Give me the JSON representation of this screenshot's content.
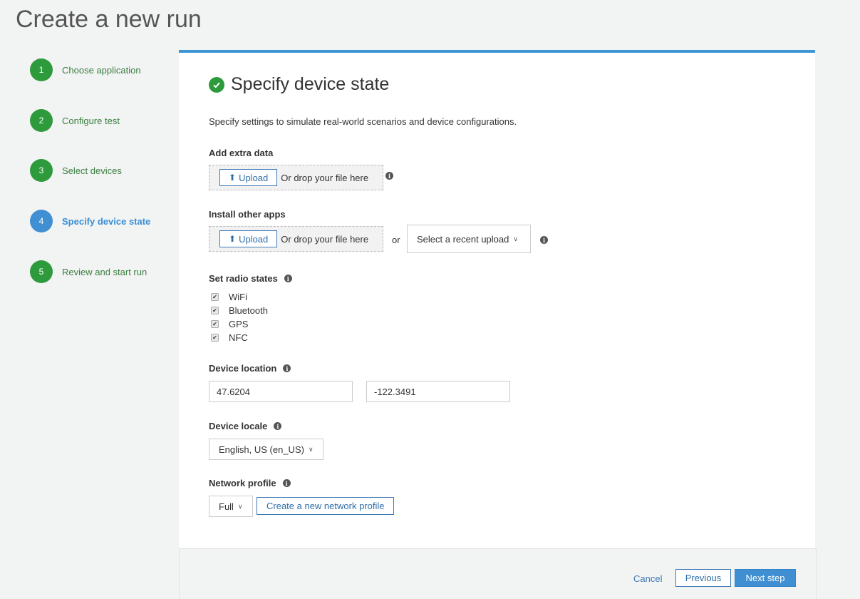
{
  "page": {
    "title": "Create a new run"
  },
  "steps": [
    {
      "num": "1",
      "label": "Choose application"
    },
    {
      "num": "2",
      "label": "Configure test"
    },
    {
      "num": "3",
      "label": "Select devices"
    },
    {
      "num": "4",
      "label": "Specify device state"
    },
    {
      "num": "5",
      "label": "Review and start run"
    }
  ],
  "active_step": "4",
  "colors": {
    "accent": "#3f8fd2",
    "done": "#2d9a3b",
    "link": "#2f6fa8"
  },
  "panel": {
    "title": "Specify device state",
    "description": "Specify settings to simulate real-world scenarios and device configurations."
  },
  "extra_data": {
    "label": "Add extra data",
    "upload_label": "Upload",
    "drop_text": "Or drop your file here"
  },
  "other_apps": {
    "label": "Install other apps",
    "upload_label": "Upload",
    "drop_text": "Or drop your file here",
    "or_text": "or",
    "recent_upload": "Select a recent upload"
  },
  "radio_states": {
    "label": "Set radio states",
    "items": [
      {
        "label": "WiFi",
        "checked": true
      },
      {
        "label": "Bluetooth",
        "checked": true
      },
      {
        "label": "GPS",
        "checked": true
      },
      {
        "label": "NFC",
        "checked": true
      }
    ]
  },
  "location": {
    "label": "Device location",
    "latitude": "47.6204",
    "longitude": "-122.3491"
  },
  "locale": {
    "label": "Device locale",
    "value": "English, US (en_US)"
  },
  "network": {
    "label": "Network profile",
    "value": "Full",
    "create_label": "Create a new network profile"
  },
  "footer": {
    "cancel": "Cancel",
    "previous": "Previous",
    "next": "Next step"
  }
}
